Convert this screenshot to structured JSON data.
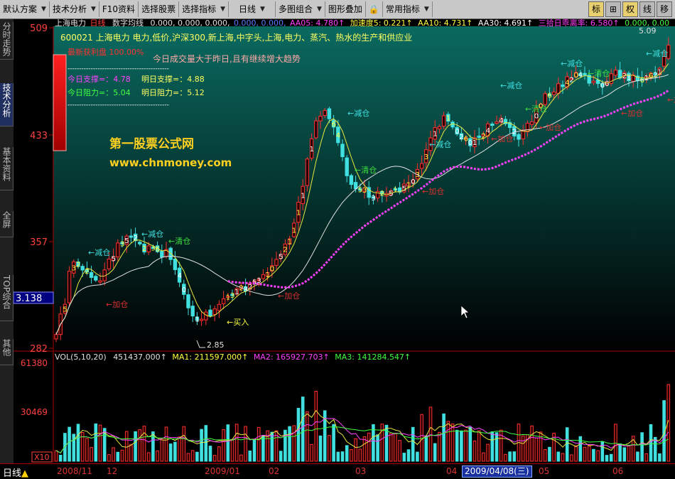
{
  "menubar": {
    "items": [
      "默认方案",
      "技术分析",
      "F10资料",
      "选择股票",
      "选择指标",
      "日线",
      "多图组合",
      "图形叠加",
      "常用指标"
    ],
    "tool_buttons": [
      "标",
      "⊞",
      "权",
      "线",
      "移"
    ]
  },
  "left_tabs": [
    "分时走势",
    "技术分析",
    "基本资料",
    "全屏",
    "TOP综合",
    "其他"
  ],
  "chart_header": {
    "stock": "上海电力",
    "period": "日线",
    "indicator": "数字均线",
    "values": "0.000, 0.000, 0.000,",
    "values_blue": "0.000, 0.000,",
    "aa05": "AA05: 4.780↑",
    "accel": "加速度5: 0.221↑",
    "aa10": "AA10: 4.731↑",
    "aa30": "AA30: 4.691↑",
    "bias": "三拾日乖离率: 6.580↑",
    "tail": "0.000, 0.00"
  },
  "info": {
    "code_line": "600021 上海电力 电力,低价,沪深300,新上海,中字头,上海,电力、蒸汽、热水的生产和供应业",
    "profit_label": "最新获利盘 100.00%",
    "note": "今日成交量大于昨日,且有继续增大趋势",
    "support_today": "今日支撑=：4.78",
    "support_tomorrow": "明日支撑=：4.88",
    "resist_today": "今日阻力=：5.04",
    "resist_tomorrow": "明日阻力=：5.12",
    "dashes": "--------------------------------------------",
    "watermark_cn": "第一股票公式网",
    "watermark_url": "www.chnmoney.com"
  },
  "price_axis": {
    "labels": [
      "509",
      "433",
      "357",
      "282"
    ],
    "current": "3.138",
    "high_note": "5.09",
    "low_note": "2.85"
  },
  "signals": [
    {
      "text": "减仓",
      "color": "#40e0e0"
    },
    {
      "text": "减仓",
      "color": "#40e0e0"
    },
    {
      "text": "清仓",
      "color": "#40e040"
    },
    {
      "text": "加仓",
      "color": "#e03030"
    },
    {
      "text": "买入",
      "color": "#ffff40"
    },
    {
      "text": "加仓",
      "color": "#e03030"
    },
    {
      "text": "减仓",
      "color": "#40e0e0"
    },
    {
      "text": "清仓",
      "color": "#40e040"
    },
    {
      "text": "加仓",
      "color": "#e03030"
    },
    {
      "text": "减仓",
      "color": "#40e0e0"
    },
    {
      "text": "减仓",
      "color": "#40e0e0"
    },
    {
      "text": "清仓",
      "color": "#40e040"
    },
    {
      "text": "减仓",
      "color": "#40e0e0"
    },
    {
      "text": "加仓",
      "color": "#e03030"
    },
    {
      "text": "清仓",
      "color": "#40e040"
    },
    {
      "text": "加仓",
      "color": "#e03030"
    },
    {
      "text": "减仓",
      "color": "#40e0e0"
    },
    {
      "text": "加仓",
      "color": "#e03030"
    },
    {
      "text": "加仓",
      "color": "#e03030"
    }
  ],
  "volume": {
    "label": "VOL(5,10,20)",
    "value": "451437.000↑",
    "ma1": "MA1: 211597.000↑",
    "ma2": "MA2: 165927.703↑",
    "ma3": "MA3: 141284.547↑",
    "axis_labels": [
      "61380",
      "30469"
    ],
    "unit": "X10"
  },
  "timebar": {
    "period": "日线",
    "labels": [
      "2008/11",
      "12",
      "2009/01",
      "02",
      "03",
      "04",
      "05",
      "06"
    ],
    "selected_date": "2009/04/08(三)"
  },
  "colors": {
    "up": "#ff3030",
    "down": "#40e0e0",
    "accent": "#ffff40",
    "ma_white": "#e0e0e0",
    "ma_yellow": "#e8e840",
    "ma_magenta": "#ff40ff",
    "bg_gradient_top": "#0a6a60",
    "bg_gradient_bottom": "#000000"
  }
}
